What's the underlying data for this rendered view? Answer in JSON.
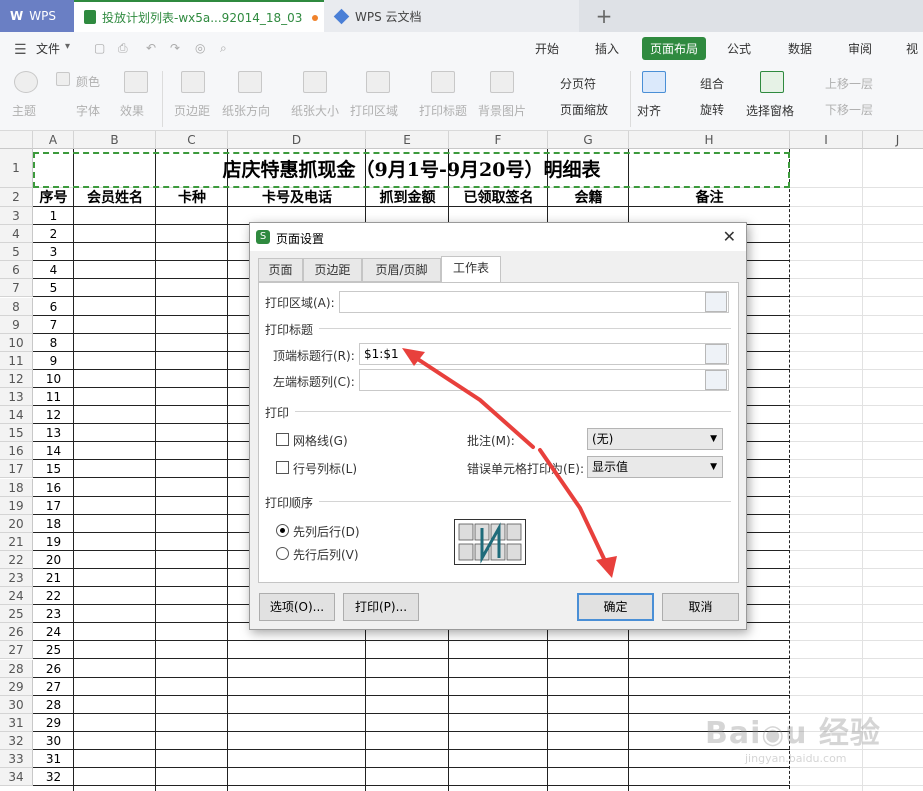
{
  "tabs": {
    "wps": "WPS",
    "doc": "投放计划列表-wx5a...92014_18_03",
    "cloud": "WPS 云文档",
    "new": "+"
  },
  "menu": {
    "file": "文件",
    "items": [
      "开始",
      "插入",
      "页面布局",
      "公式",
      "数据",
      "审阅",
      "视"
    ]
  },
  "ribbon": {
    "theme": "主题",
    "colors": "颜色",
    "fonts": "字体",
    "effects": "效果",
    "margins": "页边距",
    "orientation": "纸张方向",
    "size": "纸张大小",
    "print_area": "打印区域",
    "print_titles": "打印标题",
    "background": "背景图片",
    "page_break": "分页符",
    "page_scale": "页面缩放",
    "align": "对齐",
    "group": "组合",
    "rotate": "旋转",
    "selection_pane": "选择窗格",
    "bring_forward": "上移一层",
    "send_backward": "下移一层"
  },
  "sheet": {
    "columns": [
      "A",
      "B",
      "C",
      "D",
      "E",
      "F",
      "G",
      "H",
      "I",
      "J"
    ],
    "title": "店庆特惠抓现金（9月1号-9月20号）明细表",
    "headers": [
      "序号",
      "会员姓名",
      "卡种",
      "卡号及电话",
      "抓到金额",
      "已领取签名",
      "会籍",
      "备注"
    ],
    "row_numbers": [
      "1",
      "2",
      "3",
      "4",
      "5",
      "6",
      "7",
      "8",
      "9",
      "10",
      "11",
      "12",
      "13",
      "14",
      "15",
      "16",
      "17",
      "18",
      "19",
      "20",
      "21",
      "22",
      "23",
      "24",
      "25",
      "26",
      "27",
      "28",
      "29",
      "30",
      "31",
      "32",
      "33",
      "34"
    ],
    "seq": [
      "1",
      "2",
      "3",
      "4",
      "5",
      "6",
      "7",
      "8",
      "9",
      "10",
      "11",
      "12",
      "13",
      "14",
      "15",
      "16",
      "17",
      "18",
      "19",
      "20",
      "21",
      "22",
      "23",
      "24",
      "25",
      "26",
      "27",
      "28",
      "29",
      "30",
      "31",
      "32"
    ]
  },
  "dialog": {
    "title": "页面设置",
    "tabs": [
      "页面",
      "页边距",
      "页眉/页脚",
      "工作表"
    ],
    "print_area_label": "打印区域(A):",
    "print_titles_group": "打印标题",
    "top_rows_label": "顶端标题行(R):",
    "top_rows_value": "$1:$1",
    "left_cols_label": "左端标题列(C):",
    "print_group": "打印",
    "gridlines": "网格线(G)",
    "row_col_headers": "行号列标(L)",
    "comments_label": "批注(M):",
    "comments_value": "(无)",
    "errors_label": "错误单元格打印为(E):",
    "errors_value": "显示值",
    "order_group": "打印顺序",
    "down_then_over": "先列后行(D)",
    "over_then_down": "先行后列(V)",
    "options_btn": "选项(O)...",
    "print_btn": "打印(P)...",
    "ok_btn": "确定",
    "cancel_btn": "取消"
  },
  "colors": {
    "arrow": "#e8403c",
    "accent": "#2f8a3f",
    "title_border": "#3c9a3c"
  }
}
